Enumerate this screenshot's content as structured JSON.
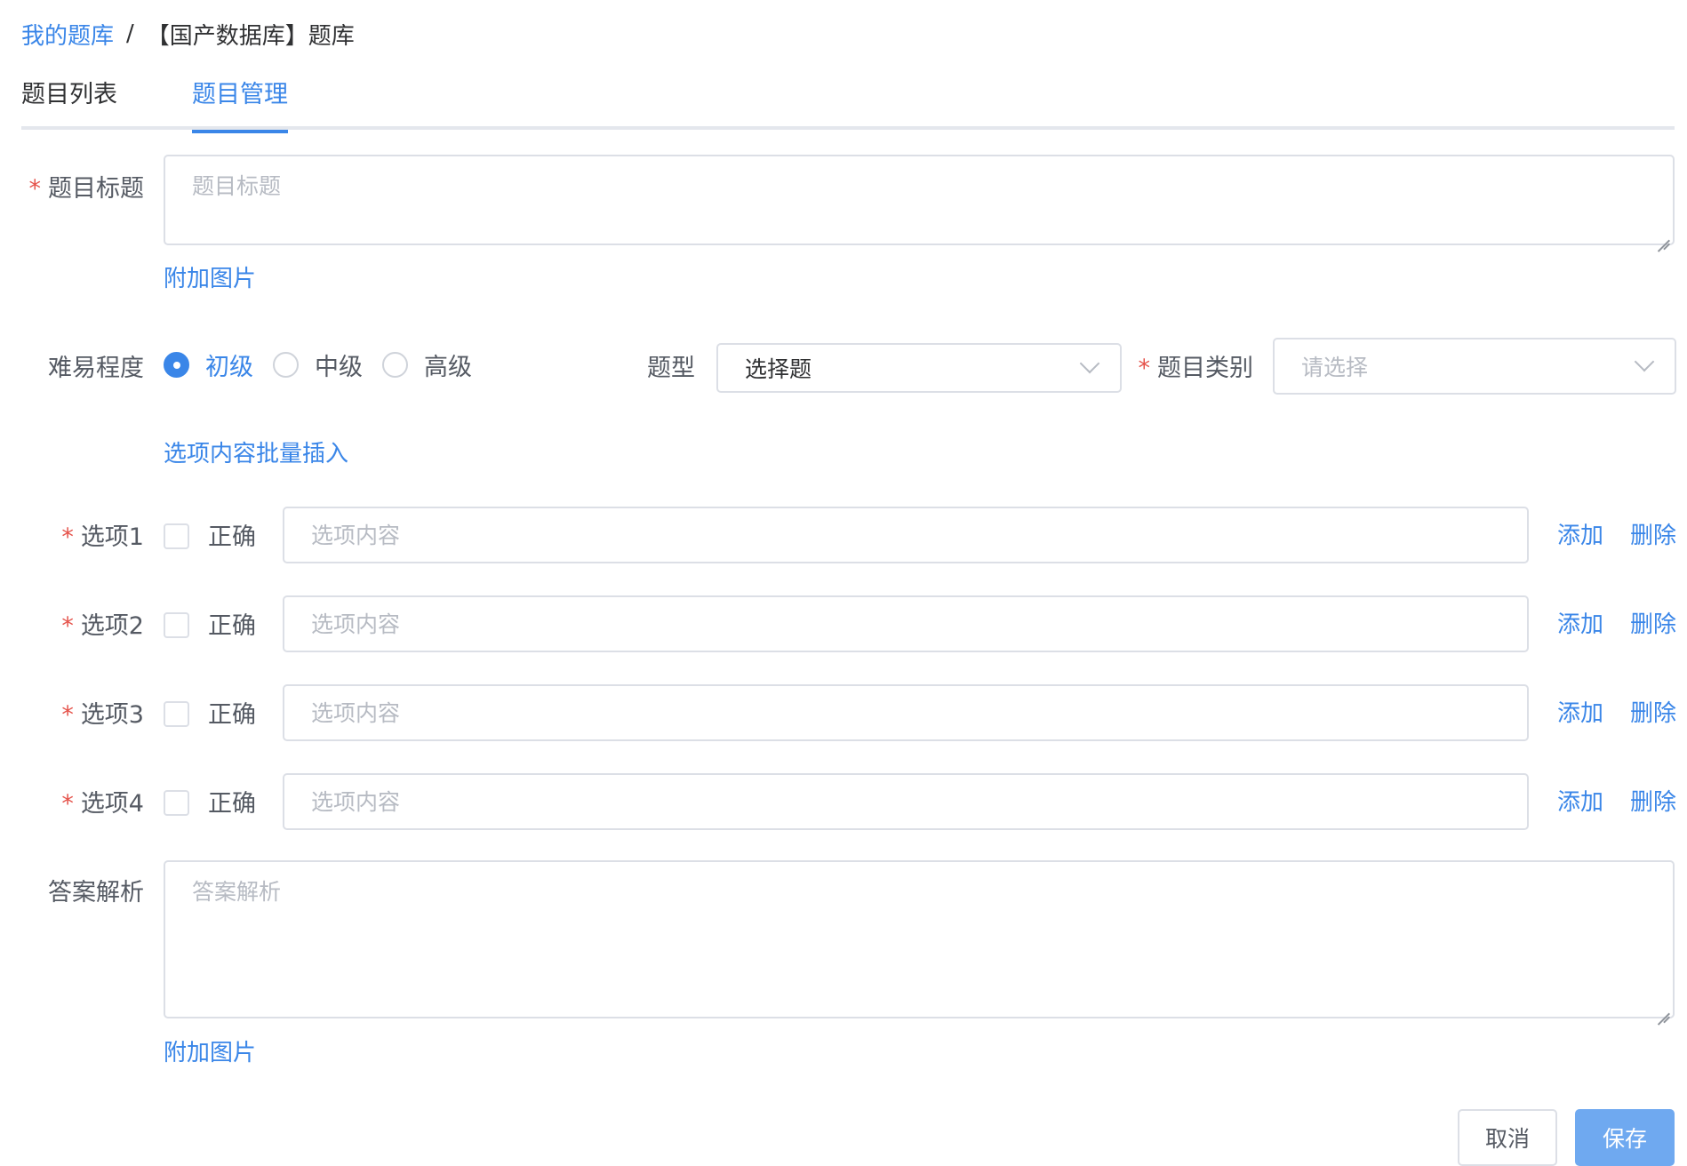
{
  "breadcrumb": {
    "root": "我的题库",
    "separator": "/",
    "current": "【国产数据库】题库"
  },
  "tabs": [
    {
      "label": "题目列表",
      "active": false
    },
    {
      "label": "题目管理",
      "active": true
    }
  ],
  "form": {
    "title": {
      "label": "题目标题",
      "required": true,
      "placeholder": "题目标题",
      "value": "",
      "attach_link": "附加图片"
    },
    "difficulty": {
      "label": "难易程度",
      "options": [
        "初级",
        "中级",
        "高级"
      ],
      "selected": "初级"
    },
    "question_type": {
      "label": "题型",
      "value": "选择题"
    },
    "category": {
      "label": "题目类别",
      "required": true,
      "placeholder": "请选择",
      "value": ""
    },
    "batch_insert_link": "选项内容批量插入",
    "options": [
      {
        "label": "选项1",
        "correct_label": "正确",
        "checked": false,
        "placeholder": "选项内容",
        "value": "",
        "add_label": "添加",
        "delete_label": "删除"
      },
      {
        "label": "选项2",
        "correct_label": "正确",
        "checked": false,
        "placeholder": "选项内容",
        "value": "",
        "add_label": "添加",
        "delete_label": "删除"
      },
      {
        "label": "选项3",
        "correct_label": "正确",
        "checked": false,
        "placeholder": "选项内容",
        "value": "",
        "add_label": "添加",
        "delete_label": "删除"
      },
      {
        "label": "选项4",
        "correct_label": "正确",
        "checked": false,
        "placeholder": "选项内容",
        "value": "",
        "add_label": "添加",
        "delete_label": "删除"
      }
    ],
    "analysis": {
      "label": "答案解析",
      "placeholder": "答案解析",
      "value": "",
      "attach_link": "附加图片"
    }
  },
  "actions": {
    "cancel_label": "取消",
    "save_label": "保存"
  },
  "colors": {
    "primary": "#3a86e8",
    "required": "#e5534b",
    "save_button": "#6fa9f0"
  }
}
